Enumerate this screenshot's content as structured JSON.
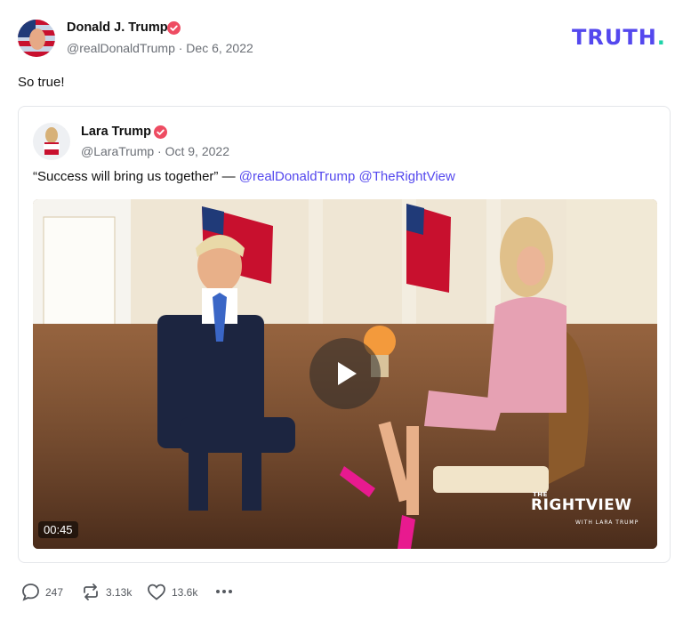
{
  "post": {
    "author_name": "Donald J. Trump",
    "handle_date": "@realDonaldTrump · Dec 6, 2022",
    "text": "So true!"
  },
  "brand_logo": {
    "word": "TRUTH",
    "dot": "."
  },
  "quoted": {
    "author_name": "Lara Trump",
    "handle_date": "@LaraTrump · Oct 9, 2022",
    "text": "“Success will bring us together” — ",
    "mentions": [
      "@realDonaldTrump",
      "@TheRightView"
    ],
    "video": {
      "duration": "00:45",
      "overlay_brand": "RIGHTVIEW",
      "overlay_brand_prefix": "THE",
      "overlay_sub": "WITH LARA TRUMP"
    }
  },
  "actions": {
    "replies": "247",
    "retruths": "3.13k",
    "likes": "13.6k"
  },
  "colors": {
    "accent": "#5448ee",
    "verified": "#ee4c62",
    "logo_dot": "#1ed3a8"
  }
}
